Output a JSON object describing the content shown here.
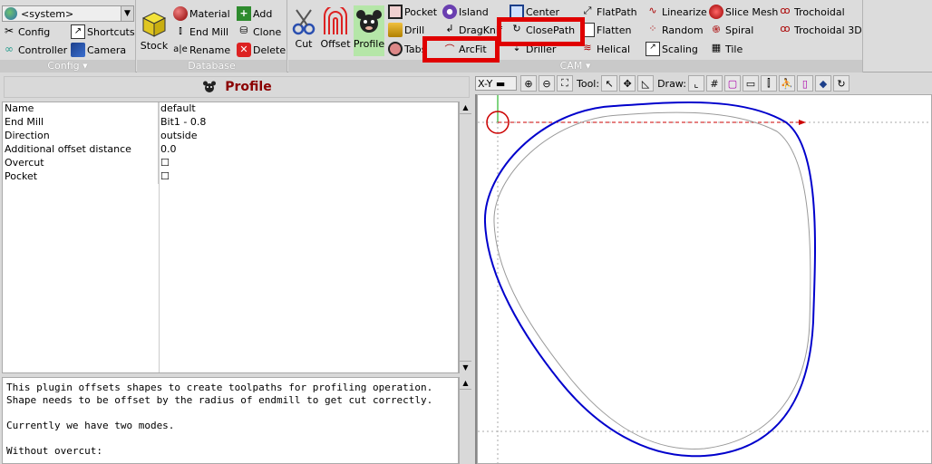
{
  "config_group": {
    "label": "Config",
    "system_select": "<system>",
    "items": {
      "config": "Config",
      "shortcuts": "Shortcuts",
      "controller": "Controller",
      "camera": "Camera"
    }
  },
  "database_group": {
    "label": "Database",
    "stock": "Stock",
    "items": {
      "material": "Material",
      "add": "Add",
      "endmill": "End Mill",
      "clone": "Clone",
      "rename": "Rename",
      "delete": "Delete"
    }
  },
  "cam_group": {
    "label": "CAM",
    "big": {
      "cut": "Cut",
      "offset": "Offset",
      "profile": "Profile"
    },
    "col1": [
      "Pocket",
      "Drill",
      "Tabs"
    ],
    "col2": [
      "Island",
      "DragKnif",
      "ArcFit"
    ],
    "col3": [
      "Center",
      "ClosePath",
      "Driller"
    ],
    "col4": [
      "FlatPath",
      "Flatten",
      "Helical"
    ],
    "col5": [
      "Linearize",
      "Random",
      "Scaling"
    ],
    "col6": [
      "Slice Mesh",
      "Spiral",
      "Tile"
    ],
    "col7": [
      "Trochoidal",
      "Trochoidal 3D"
    ]
  },
  "panel": {
    "title": "Profile",
    "properties": [
      {
        "key": "Name",
        "value": "default"
      },
      {
        "key": "End Mill",
        "value": "Bit1 - 0.8"
      },
      {
        "key": "Direction",
        "value": "outside"
      },
      {
        "key": "Additional offset distance",
        "value": "0.0"
      },
      {
        "key": "Overcut",
        "value": "☐"
      },
      {
        "key": "Pocket",
        "value": "☐"
      }
    ],
    "description": "This plugin offsets shapes to create toolpaths for profiling operation.\nShape needs to be offset by the radius of endmill to get cut correctly.\n\nCurrently we have two modes.\n\nWithout overcut:"
  },
  "canvas_toolbar": {
    "view": "X-Y",
    "tool_label": "Tool:",
    "draw_label": "Draw:"
  },
  "colors": {
    "path": "#0000cc",
    "offset": "#999999",
    "highlight": "#e00000",
    "origin": "#cc0000"
  }
}
